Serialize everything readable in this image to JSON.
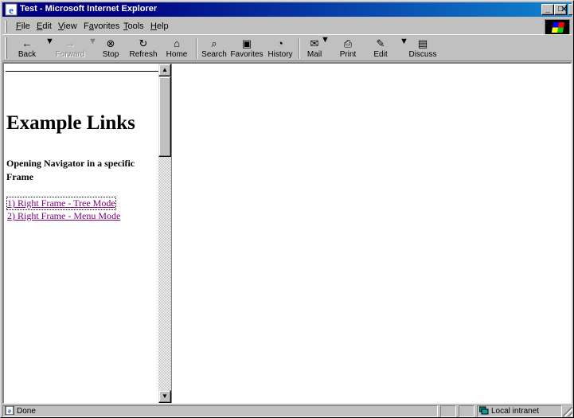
{
  "window": {
    "title": "Test - Microsoft Internet Explorer",
    "controls": {
      "minimize": "_",
      "maximize": "□",
      "close": "✕"
    }
  },
  "menu": {
    "items": [
      {
        "key": "F",
        "rest": "ile"
      },
      {
        "key": "E",
        "rest": "dit"
      },
      {
        "key": "V",
        "rest": "iew"
      },
      {
        "pre": "F",
        "key": "a",
        "rest": "vorites"
      },
      {
        "key": "T",
        "rest": "ools"
      },
      {
        "key": "H",
        "rest": "elp"
      }
    ]
  },
  "toolbar": {
    "back": {
      "label": "Back",
      "icon": "←"
    },
    "forward": {
      "label": "Forward",
      "icon": "→"
    },
    "stop": {
      "label": "Stop",
      "icon": "⊗"
    },
    "refresh": {
      "label": "Refresh",
      "icon": "↻"
    },
    "home": {
      "label": "Home",
      "icon": "⌂"
    },
    "search": {
      "label": "Search",
      "icon": "⌕"
    },
    "favorites": {
      "label": "Favorites",
      "icon": "▣"
    },
    "history": {
      "label": "History",
      "icon": "◔"
    },
    "mail": {
      "label": "Mail",
      "icon": "✉"
    },
    "print": {
      "label": "Print",
      "icon": "⎙"
    },
    "edit": {
      "label": "Edit",
      "icon": "✎"
    },
    "discuss": {
      "label": "Discuss",
      "icon": "▤"
    }
  },
  "left_frame": {
    "heading": "Example Links",
    "subheading": "Opening Navigator in a specific Frame",
    "links": [
      {
        "label": "1) Right Frame - Tree Mode"
      },
      {
        "label": "2) Right Frame - Menu Mode"
      }
    ],
    "link_color": "#800080"
  },
  "statusbar": {
    "text": "Done",
    "zone": "Local intranet"
  },
  "colors": {
    "titlebar_start": "#000080",
    "titlebar_end": "#1084d0",
    "chrome": "#c0c0c0"
  }
}
